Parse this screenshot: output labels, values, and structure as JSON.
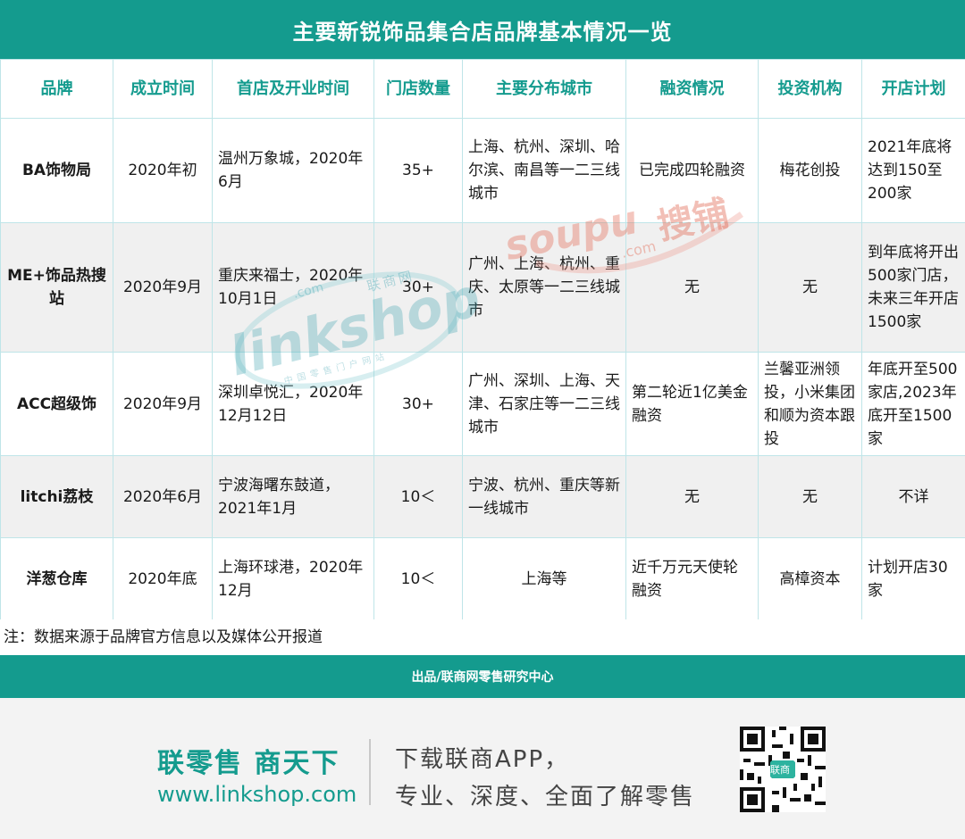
{
  "title": "主要新锐饰品集合店品牌基本情况一览",
  "headers": [
    "品牌",
    "成立时间",
    "首店及开业时间",
    "门店数量",
    "主要分布城市",
    "融资情况",
    "投资机构",
    "开店计划"
  ],
  "rows": [
    {
      "brand": "BA饰物局",
      "founded": "2020年初",
      "first_store": "温州万象城，2020年6月",
      "stores": "35+",
      "cities": "上海、杭州、深圳、哈尔滨、南昌等一二三线城市",
      "funding": "已完成四轮融资",
      "investors": "梅花创投",
      "plan": "2021年底将达到150至200家"
    },
    {
      "brand": "ME+饰品热搜站",
      "founded": "2020年9月",
      "first_store": "重庆来福士，2020年10月1日",
      "stores": "30+",
      "cities": "广州、上海、杭州、重庆、太原等一二三线城市",
      "funding": "无",
      "investors": "无",
      "plan": "到年底将开出500家门店，未来三年开店1500家"
    },
    {
      "brand": "ACC超级饰",
      "founded": "2020年9月",
      "first_store": "深圳卓悦汇，2020年12月12日",
      "stores": "30+",
      "cities": "广州、深圳、上海、天津、石家庄等一二三线城市",
      "funding": "第二轮近1亿美金融资",
      "investors": "兰馨亚洲领投，小米集团和顺为资本跟投",
      "plan": "年底开至500家店,2023年底开至1500家"
    },
    {
      "brand": "litchi荔枝",
      "founded": "2020年6月",
      "first_store": "宁波海曙东鼓道，2021年1月",
      "stores": "10＜",
      "cities": "宁波、杭州、重庆等新一线城市",
      "funding": "无",
      "investors": "无",
      "plan": "不详"
    },
    {
      "brand": "洋葱仓库",
      "founded": "2020年底",
      "first_store": "上海环球港，2020年12月",
      "stores": "10＜",
      "cities": "上海等",
      "funding": "近千万元天使轮融资",
      "investors": "高樟资本",
      "plan": "计划开店30家"
    }
  ],
  "note": "注：数据来源于品牌官方信息以及媒体公开报道",
  "credit": "出品/联商网零售研究中心",
  "footer": {
    "slogan": "联零售 商天下",
    "url": "www.linkshop.com",
    "download_line1": "下载联商APP，",
    "download_line2": "专业、深度、全面了解零售",
    "qr_label": "联商"
  },
  "watermarks": {
    "linkshop": "linkshop",
    "linkshop_cn": "联商网",
    "linkshop_com": ".com",
    "linkshop_tagline": "中国零售门户网站",
    "soupu": "soupu",
    "soupu_cn": "搜铺",
    "soupu_com": ".com"
  },
  "colors": {
    "accent": "#149b8e",
    "border": "#bfe5e8",
    "row_alt": "#f0f0f0"
  }
}
